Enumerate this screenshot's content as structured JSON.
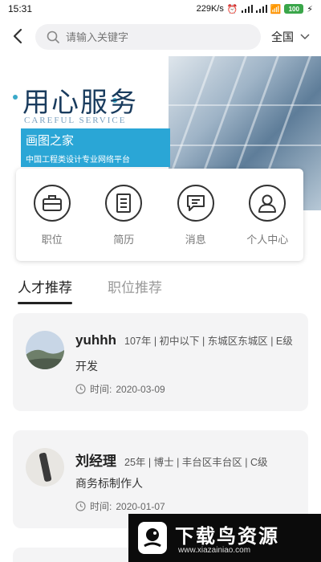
{
  "status_bar": {
    "time": "15:31",
    "network_speed": "229K/s",
    "battery": "100"
  },
  "search": {
    "placeholder": "请输入关键字"
  },
  "region": {
    "label": "全国"
  },
  "banner": {
    "title": "用心服务",
    "subtitle": "CAREFUL SERVICE",
    "brand": "画图之家",
    "slogan": "中国工程类设计专业网络平台"
  },
  "menu": {
    "items": [
      {
        "label": "职位",
        "icon": "briefcase-icon"
      },
      {
        "label": "简历",
        "icon": "document-icon"
      },
      {
        "label": "消息",
        "icon": "message-icon"
      },
      {
        "label": "个人中心",
        "icon": "user-icon"
      }
    ]
  },
  "tabs": [
    {
      "label": "人才推荐",
      "active": true
    },
    {
      "label": "职位推荐",
      "active": false
    }
  ],
  "cards": [
    {
      "name": "yuhhh",
      "meta": "107年 | 初中以下 | 东城区东城区 | E级",
      "job": "开发",
      "time_label": "时间:",
      "time": "2020-03-09"
    },
    {
      "name": "刘经理",
      "meta": "25年 | 博士 | 丰台区丰台区 | C级",
      "job": "商务标制作人",
      "time_label": "时间:",
      "time": "2020-01-07"
    }
  ],
  "watermark": {
    "title": "下载鸟资源",
    "url": "www.xiazainiao.com"
  },
  "colors": {
    "accent": "#2aa6d6",
    "card_bg": "#f4f4f5",
    "tab_active": "#222222"
  }
}
